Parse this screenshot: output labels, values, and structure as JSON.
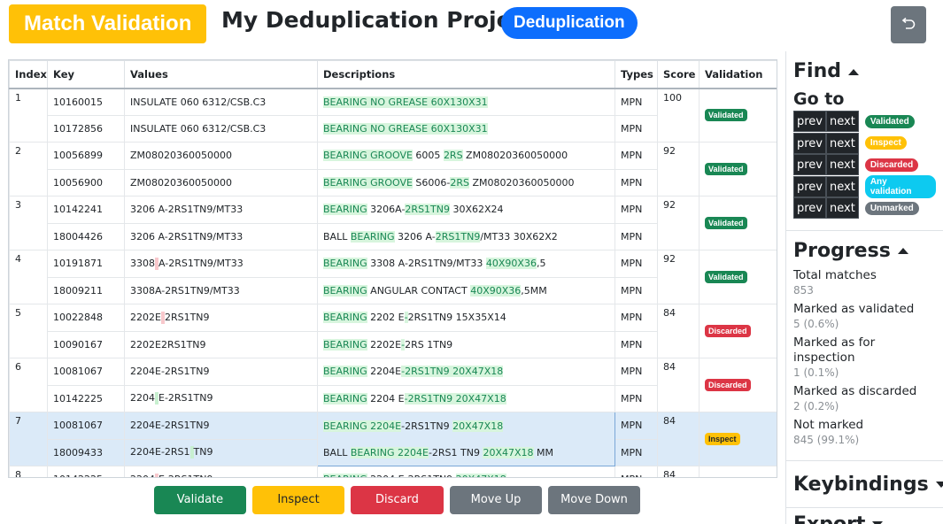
{
  "header": {
    "badge": "Match Validation",
    "project": "My Deduplication Project",
    "mode": "Deduplication",
    "undo_icon": "undo-icon"
  },
  "table": {
    "columns": [
      "Index",
      "Key",
      "Values",
      "Descriptions",
      "Types",
      "Score",
      "Validation"
    ]
  },
  "actions": {
    "validate": "Validate",
    "inspect": "Inspect",
    "discard": "Discard",
    "move_up": "Move Up",
    "move_down": "Move Down"
  },
  "sidebar": {
    "find_title": "Find",
    "goto": "Go to",
    "prev": "prev",
    "next": "next",
    "filters": [
      "Validated",
      "Inspect",
      "Discarded",
      "Any validation",
      "Unmarked"
    ],
    "progress_title": "Progress",
    "stats": [
      {
        "label": "Total matches",
        "value": "853"
      },
      {
        "label": "Marked as validated",
        "value": "5 (0.6%)"
      },
      {
        "label": "Marked as for inspection",
        "value": "1 (0.1%)"
      },
      {
        "label": "Marked as discarded",
        "value": "2 (0.2%)"
      },
      {
        "label": "Not marked",
        "value": "845 (99.1%)"
      }
    ],
    "keybindings_title": "Keybindings",
    "export_title": "Export"
  },
  "colors": {
    "validated": "#198754",
    "inspect": "#ffc107",
    "discarded": "#dc3545",
    "any_validation": "#0dcaf0",
    "unmarked": "#6c757d",
    "mode": "#0d6efd"
  }
}
